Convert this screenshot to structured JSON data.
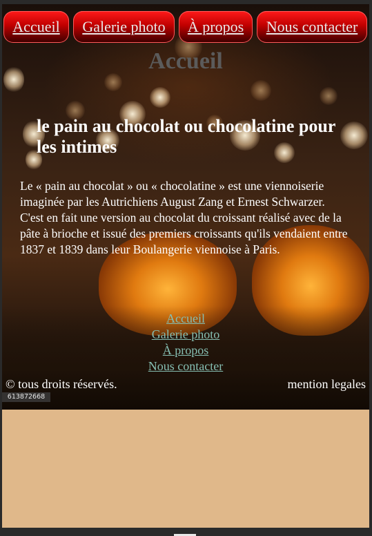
{
  "nav": {
    "items": [
      {
        "label": "Accueil"
      },
      {
        "label": "Galerie photo"
      },
      {
        "label": "À propos"
      },
      {
        "label": "Nous contacter"
      }
    ]
  },
  "main": {
    "page_title": "Accueil",
    "article_heading": "le pain au chocolat ou chocolatine pour les intimes",
    "article_body": "Le « pain au chocolat » ou « chocolatine » est une viennoiserie imaginée par les Autrichiens August Zang et Ernest Schwarzer. C'est en fait une version au chocolat du croissant réalisé avec de la pâte à brioche et issué des premiers croissants qu'ils vendaient entre 1837 et 1839 dans leur Boulangerie viennoise à Paris."
  },
  "footer": {
    "links": [
      {
        "label": "Accueil"
      },
      {
        "label": "Galerie photo"
      },
      {
        "label": "À propos"
      },
      {
        "label": "Nous contacter"
      }
    ],
    "copyright": "© tous droits réservés.",
    "legal": "mention legales"
  },
  "image": {
    "watermark_id": "613872668"
  },
  "colors": {
    "nav_button_top": "#ff1a1a",
    "nav_button_bottom": "#3a0000",
    "nav_text": "#e9e9e9",
    "page_title": "#5b5b5b",
    "footer_link": "#86bfb3",
    "page_background": "#e0b88a"
  }
}
